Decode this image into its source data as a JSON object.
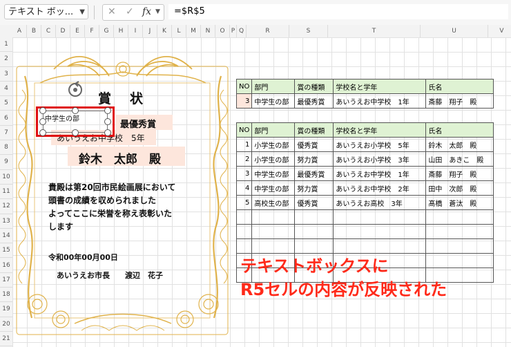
{
  "formula_bar": {
    "name_box": "テキスト ボッ...",
    "cancel_glyph": "✕",
    "enter_glyph": "✓",
    "fx_glyph": "fx",
    "formula": "=$R$5"
  },
  "columns": [
    "A",
    "B",
    "C",
    "D",
    "E",
    "F",
    "G",
    "H",
    "I",
    "J",
    "K",
    "L",
    "M",
    "N",
    "O",
    "P",
    "Q",
    "R",
    "S",
    "T",
    "U",
    "V"
  ],
  "rows": [
    "1",
    "2",
    "3",
    "4",
    "5",
    "6",
    "7",
    "8",
    "9",
    "10",
    "11",
    "12",
    "13",
    "14",
    "15",
    "16",
    "17",
    "18",
    "19",
    "20",
    "21"
  ],
  "certificate": {
    "title": "賞　状",
    "textbox_value": "中学生の部",
    "award": "最優秀賞",
    "school": "あいうえお中学校　5年",
    "recipient": "鈴木　太郎　殿",
    "body_lines": [
      "貴殿は第20回市民絵画展において",
      "頭書の成績を収められました",
      "よってここに栄誉を称え表彰いた",
      "します"
    ],
    "date": "令和00年00月00日",
    "signer": "あいうえお市長　　渡辺　花子"
  },
  "lookup_table": {
    "headers": [
      "NO",
      "部門",
      "賞の種類",
      "学校名と学年",
      "氏名"
    ],
    "row": [
      "3",
      "中学生の部",
      "最優秀賞",
      "あいうえお中学校　1年",
      "斎藤　翔子　殿"
    ]
  },
  "data_table": {
    "headers": [
      "NO",
      "部門",
      "賞の種類",
      "学校名と学年",
      "氏名"
    ],
    "rows": [
      [
        "1",
        "小学生の部",
        "優秀賞",
        "あいうえお小学校　5年",
        "鈴木　太郎　殿"
      ],
      [
        "2",
        "小学生の部",
        "努力賞",
        "あいうえお小学校　3年",
        "山田　あきこ　殿"
      ],
      [
        "3",
        "中学生の部",
        "最優秀賞",
        "あいうえお中学校　1年",
        "斎藤　翔子　殿"
      ],
      [
        "4",
        "中学生の部",
        "努力賞",
        "あいうえお中学校　2年",
        "田中　次郎　殿"
      ],
      [
        "5",
        "高校生の部",
        "優秀賞",
        "あいうえお高校　3年",
        "髙橋　蒼汰　殿"
      ],
      [
        "",
        "",
        "",
        "",
        ""
      ],
      [
        "",
        "",
        "",
        "",
        ""
      ],
      [
        "",
        "",
        "",
        "",
        ""
      ],
      [
        "",
        "",
        "",
        "",
        ""
      ],
      [
        "",
        "",
        "",
        "",
        ""
      ]
    ]
  },
  "caption": {
    "line1": "テキストボックスに",
    "line2": "R5セルの内容が反映された"
  },
  "colors": {
    "header_fill": "#dff2d3",
    "highlight_red": "#e01010",
    "caption_red": "#ff2a1a",
    "ornament_gold": "#e0b24a",
    "textbox_fill": "#fde6dc"
  }
}
